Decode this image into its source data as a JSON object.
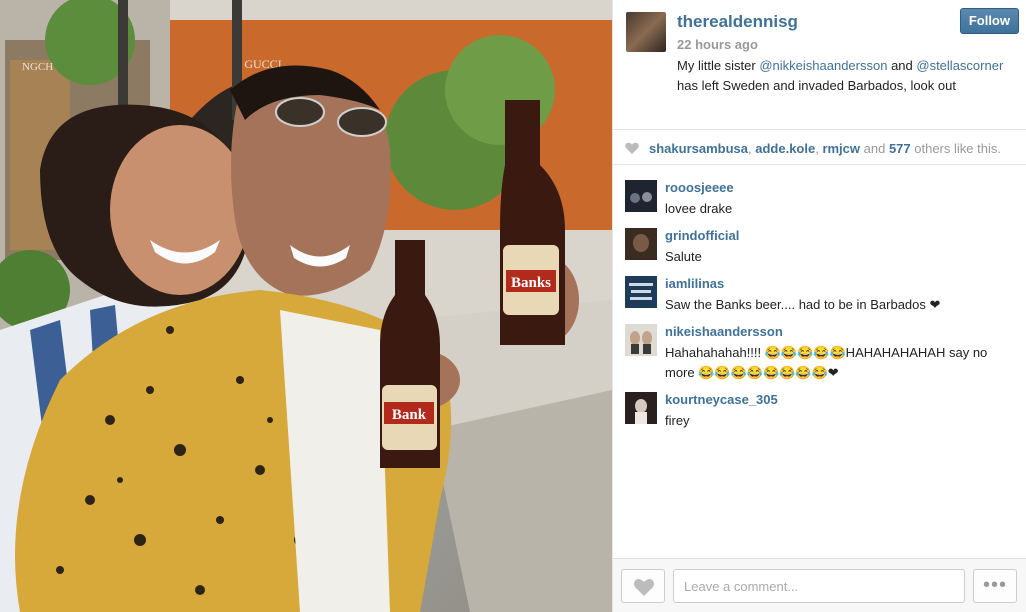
{
  "post": {
    "owner": "therealdennisg",
    "time_ago": "22 hours ago",
    "caption_start": "My little sister ",
    "mention_1": "@nikkeishaandersson",
    "caption_mid": " and ",
    "mention_2": "@stellascorner",
    "caption_end": " has left Sweden and invaded Barbados, look out",
    "follow_label": "Follow"
  },
  "photo": {
    "storefront_sign": "GUCCI",
    "storefront_sign_left": "NGCH",
    "bottle_label": "Banks",
    "bottle_label_2": "Bank"
  },
  "likes": {
    "user_1": "shakursambusa",
    "sep_1": ", ",
    "user_2": "adde.kole",
    "sep_2": ", ",
    "user_3": "rmjcw",
    "and_text": " and ",
    "count": "577",
    "suffix": " others like this."
  },
  "comments": [
    {
      "user": "rooosjeeee",
      "text": "lovee drake"
    },
    {
      "user": "grindofficial",
      "text": "Salute"
    },
    {
      "user": "iamlilinas",
      "text": "Saw the Banks beer.... had to be in Barbados ❤"
    },
    {
      "user": "nikeishaandersson",
      "text": "Hahahahahah!!!! 😂😂😂😂😂HAHAHAHAHAH say no more 😂😂😂😂😂😂😂😂❤"
    },
    {
      "user": "kourtneycase_305",
      "text": "firey"
    }
  ],
  "footer": {
    "comment_placeholder": "Leave a comment...",
    "more_label": "•••"
  },
  "icons": {
    "heart": "heart-icon",
    "more": "more-options-icon"
  },
  "colors": {
    "link": "#3f729b",
    "follow_button": "#3f729b",
    "muted": "#999999"
  }
}
